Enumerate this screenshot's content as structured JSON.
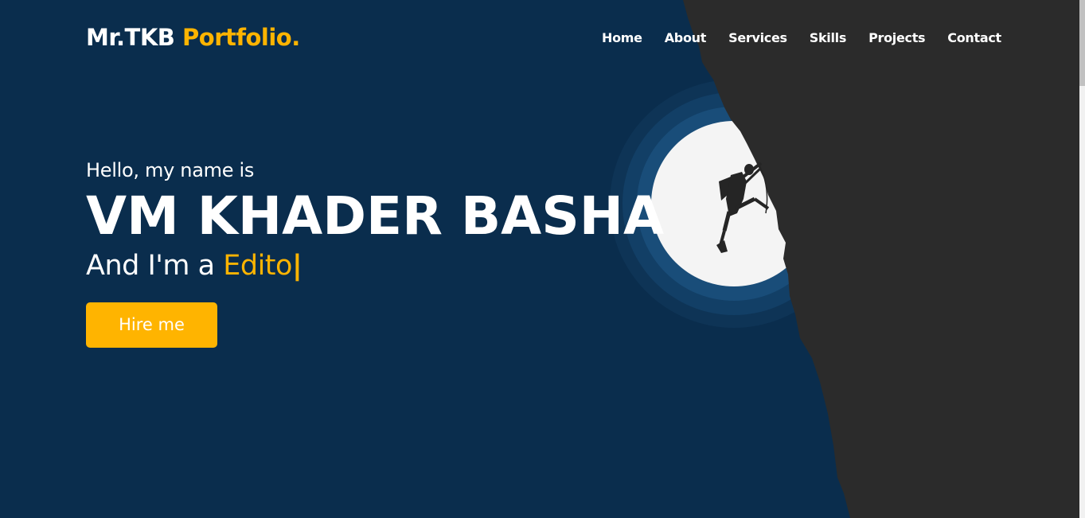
{
  "nav": {
    "logo_main": "Mr.TKB",
    "logo_accent": "Portfolio.",
    "links": [
      "Home",
      "About",
      "Services",
      "Skills",
      "Projects",
      "Contact"
    ]
  },
  "hero": {
    "greeting": "Hello, my name is",
    "name": "VM KHADER BASHA",
    "role_prefix": "And I'm a",
    "role_typed": "Edito",
    "cursor": "|",
    "cta_label": "Hire me"
  },
  "colors": {
    "background": "#0a2d4d",
    "accent": "#ffb400",
    "cliff": "#2b2b2b",
    "moon": "#f4f4f4"
  },
  "illustration": {
    "icon": "rock-climber-silhouette-icon"
  }
}
